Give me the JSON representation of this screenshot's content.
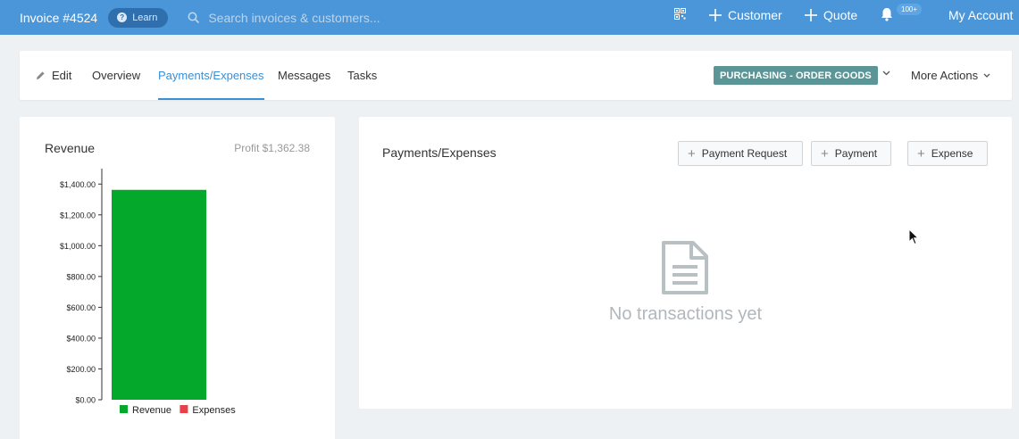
{
  "topbar": {
    "invoice_title": "Invoice #4524",
    "learn_label": "Learn",
    "search_placeholder": "Search invoices & customers...",
    "customer_label": "Customer",
    "quote_label": "Quote",
    "notifications_badge": "100+",
    "account_label": "My Account"
  },
  "tabs": {
    "edit": "Edit",
    "overview": "Overview",
    "payments_expenses": "Payments/Expenses",
    "messages": "Messages",
    "tasks": "Tasks",
    "active_tab": "Payments/Expenses"
  },
  "status": {
    "label": "PURCHASING - ORDER GOODS",
    "color": "#5b9595"
  },
  "more_actions_label": "More Actions",
  "revenue": {
    "title": "Revenue",
    "profit": "Profit $1,362.38"
  },
  "chart_data": {
    "type": "bar",
    "categories": [
      "Revenue"
    ],
    "series": [
      {
        "name": "Revenue",
        "values": [
          1362.38
        ],
        "color": "#04a82a"
      },
      {
        "name": "Expenses",
        "values": [
          0
        ],
        "color": "#e8404a"
      }
    ],
    "yticks": [
      "$0.00",
      "$200.00",
      "$400.00",
      "$600.00",
      "$800.00",
      "$1,000.00",
      "$1,200.00",
      "$1,400.00"
    ],
    "ylim": [
      0,
      1500
    ],
    "legend": "bottom"
  },
  "payments": {
    "title": "Payments/Expenses",
    "payment_request_label": "Payment Request",
    "payment_label": "Payment",
    "expense_label": "Expense",
    "empty_text": "No transactions yet"
  },
  "colors": {
    "topbar": "#4a96d8",
    "accent": "#3b8fd4"
  }
}
